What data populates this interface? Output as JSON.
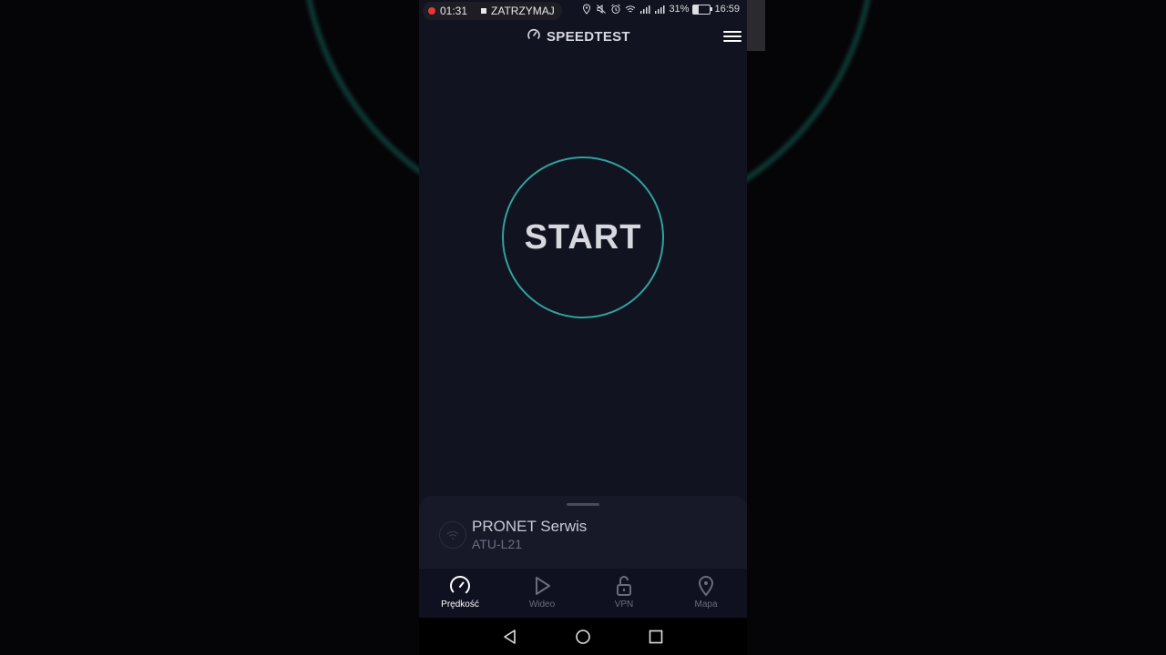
{
  "status_bar": {
    "recording_time": "01:31",
    "stop_label": "ZATRZYMAJ",
    "battery_percent": "31%",
    "battery_level": 0.31,
    "clock": "16:59"
  },
  "app_bar": {
    "title": "SPEEDTEST",
    "logo_icon": "speedometer-icon",
    "menu_icon": "hamburger-menu-icon"
  },
  "main": {
    "start_label": "START",
    "accent_color": "#2fa39a"
  },
  "connection_sheet": {
    "provider": "PRONET Serwis",
    "device": "ATU-L21",
    "icon": "wifi-icon"
  },
  "bottom_nav": {
    "items": [
      {
        "label": "Prędkość",
        "icon": "speedometer-icon",
        "active": true
      },
      {
        "label": "Wideo",
        "icon": "play-icon",
        "active": false
      },
      {
        "label": "VPN",
        "icon": "unlock-icon",
        "active": false
      },
      {
        "label": "Mapa",
        "icon": "map-pin-icon",
        "active": false
      }
    ]
  },
  "system_nav": {
    "icons": [
      "back-icon",
      "home-icon",
      "recents-icon"
    ]
  }
}
